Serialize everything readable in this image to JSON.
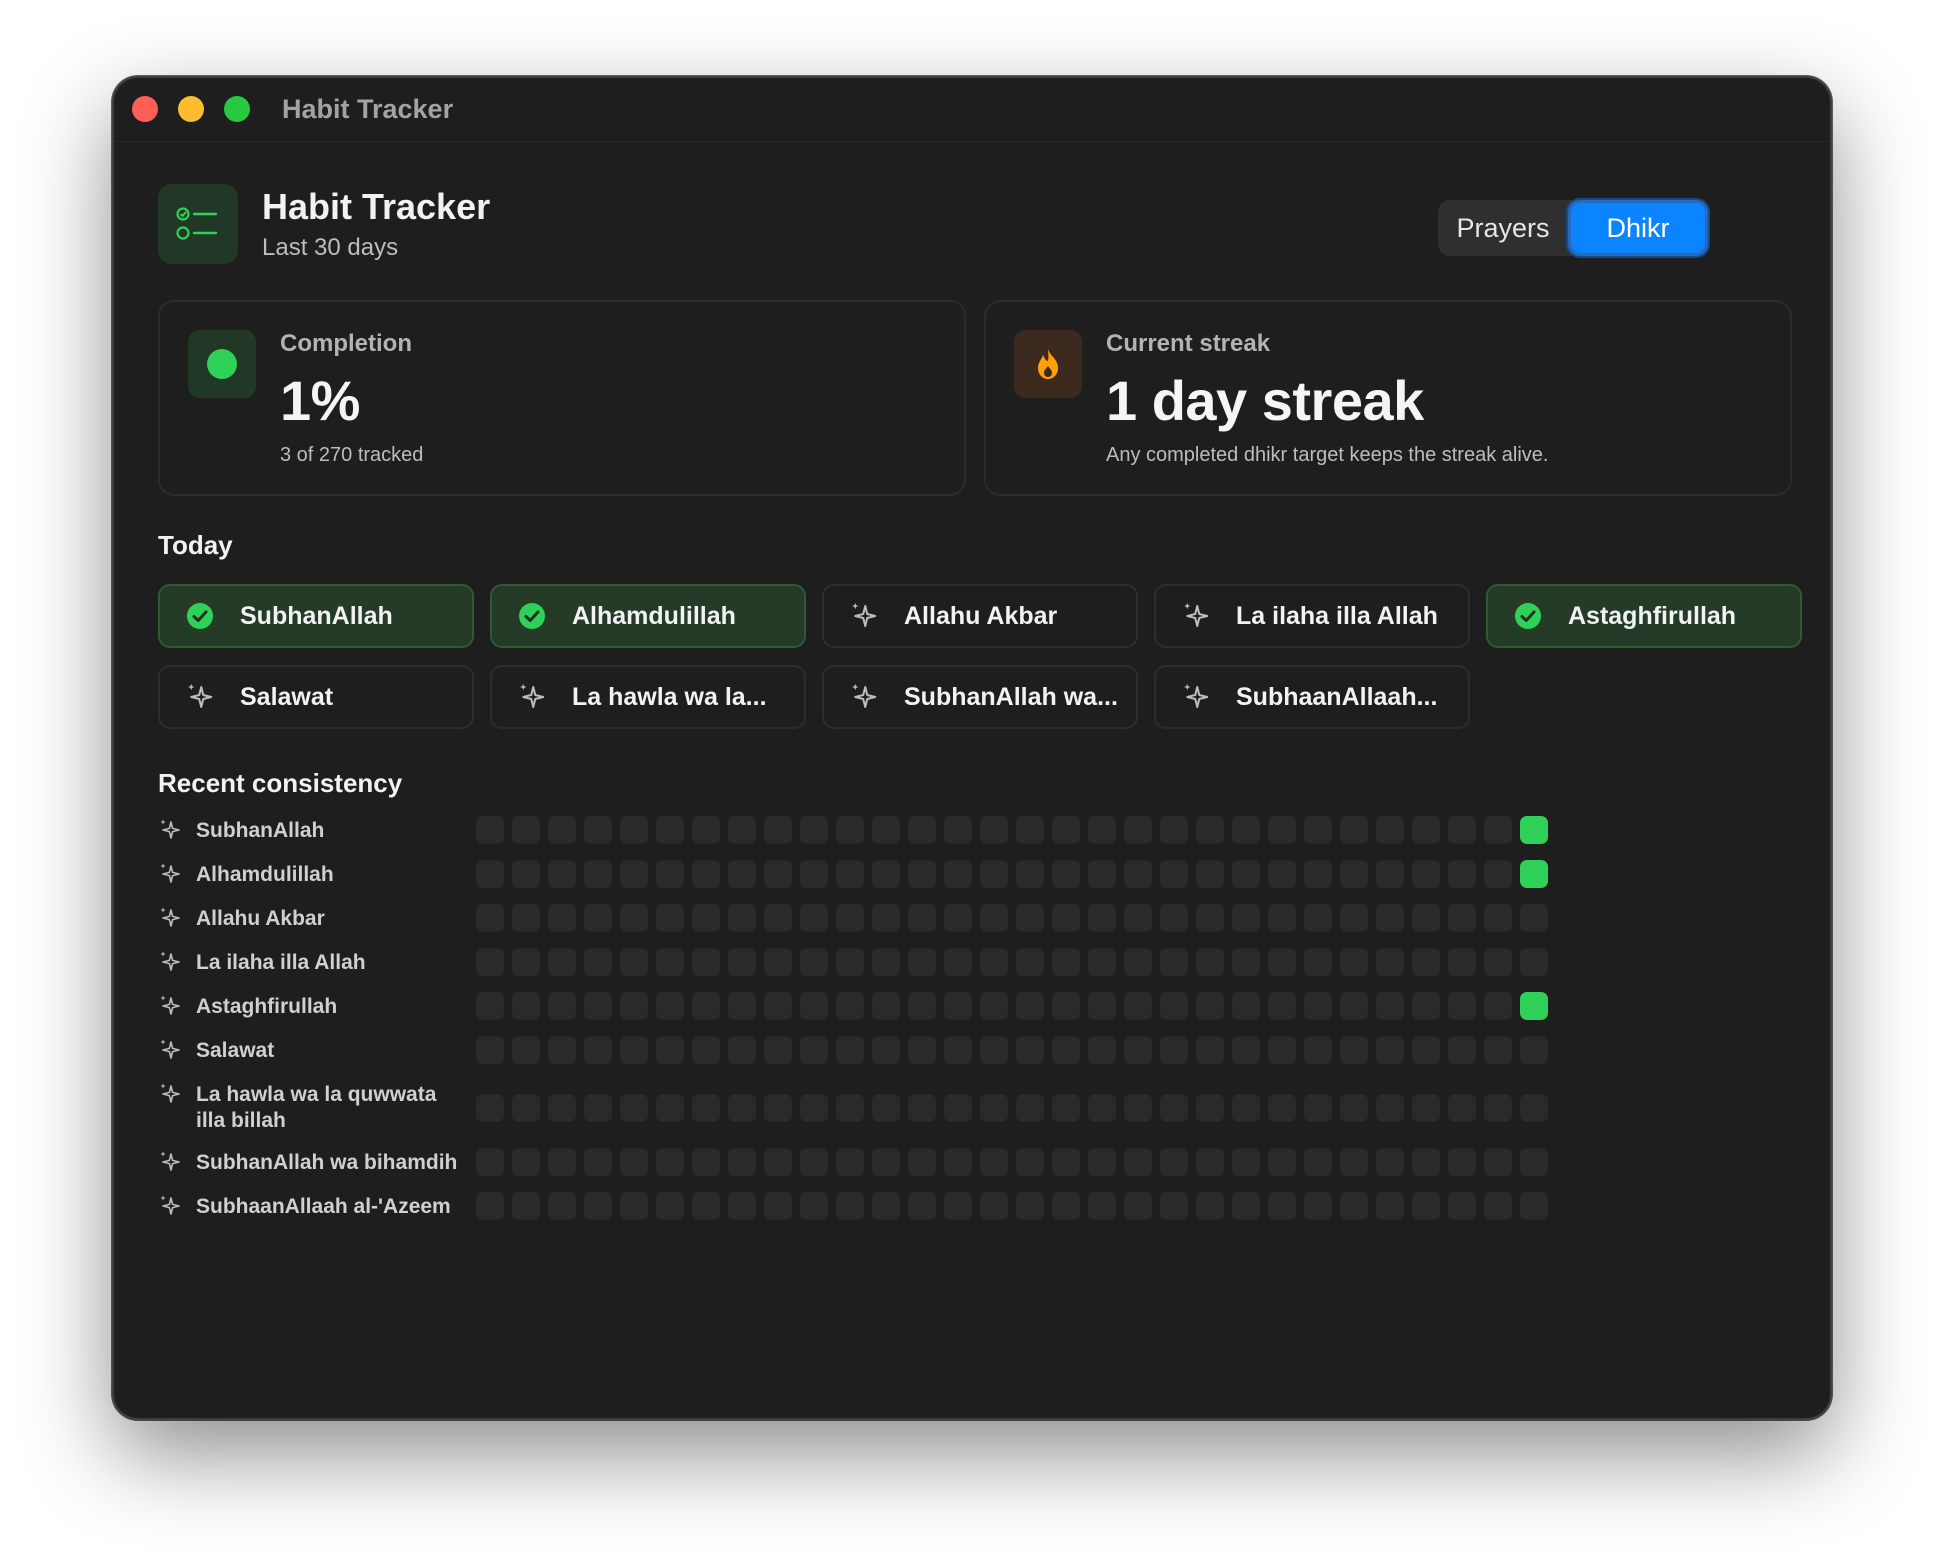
{
  "window": {
    "title": "Habit Tracker"
  },
  "header": {
    "title": "Habit Tracker",
    "subtitle": "Last 30 days",
    "icon": "checklist-icon"
  },
  "segmented": {
    "options": [
      "Prayers",
      "Dhikr"
    ],
    "selected": "Dhikr"
  },
  "stats": {
    "completion": {
      "label": "Completion",
      "value": "1%",
      "note": "3 of 270 tracked",
      "icon": "pie-chart-icon"
    },
    "streak": {
      "label": "Current streak",
      "value": "1 day streak",
      "note": "Any completed dhikr target keeps the streak alive.",
      "icon": "flame-icon"
    }
  },
  "today": {
    "title": "Today",
    "items": [
      {
        "label": "SubhanAllah",
        "done": true
      },
      {
        "label": "Alhamdulillah",
        "done": true
      },
      {
        "label": "Allahu Akbar",
        "done": false
      },
      {
        "label": "La ilaha illa Allah",
        "done": false
      },
      {
        "label": "Astaghfirullah",
        "done": true
      },
      {
        "label": "Salawat",
        "done": false
      },
      {
        "label": "La hawla wa la...",
        "done": false
      },
      {
        "label": "SubhanAllah wa...",
        "done": false
      },
      {
        "label": "SubhaanAllaah...",
        "done": false
      }
    ]
  },
  "consistency": {
    "title": "Recent consistency",
    "days": 30,
    "rows": [
      {
        "label": "SubhanAllah",
        "completed_days": [
          30
        ]
      },
      {
        "label": "Alhamdulillah",
        "completed_days": [
          30
        ]
      },
      {
        "label": "Allahu Akbar",
        "completed_days": []
      },
      {
        "label": "La ilaha illa Allah",
        "completed_days": []
      },
      {
        "label": "Astaghfirullah",
        "completed_days": [
          30
        ]
      },
      {
        "label": "Salawat",
        "completed_days": []
      },
      {
        "label": "La hawla wa la quwwata illa billah",
        "completed_days": []
      },
      {
        "label": "SubhanAllah wa bihamdih",
        "completed_days": []
      },
      {
        "label": "SubhaanAllaah al-'Azeem",
        "completed_days": []
      }
    ]
  },
  "colors": {
    "accent": "#0a84ff",
    "success": "#30d158",
    "streak": "#ff9f0a",
    "background": "#1e1e1e"
  }
}
